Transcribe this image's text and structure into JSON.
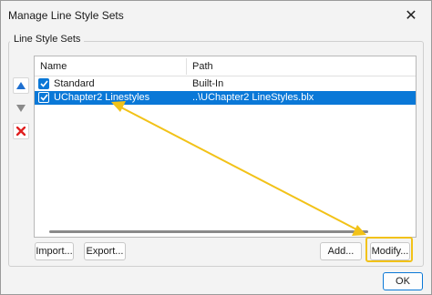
{
  "window": {
    "title": "Manage Line Style Sets",
    "close_icon": "close-icon"
  },
  "group": {
    "label": "Line Style Sets"
  },
  "side_buttons": [
    {
      "icon": "move-up-icon",
      "color": "#1e6fd0"
    },
    {
      "icon": "move-down-icon",
      "color": "#8a8a8a"
    },
    {
      "icon": "delete-icon",
      "color": "#e02020"
    }
  ],
  "list": {
    "columns": [
      "Name",
      "Path"
    ],
    "rows": [
      {
        "name": "Standard",
        "path": "Built-In",
        "checked": true,
        "selected": false
      },
      {
        "name": "UChapter2 Linestyles",
        "path": "..\\UChapter2 LineStyles.blx",
        "checked": true,
        "selected": true
      }
    ]
  },
  "buttons": {
    "import": "Import...",
    "export": "Export...",
    "add": "Add...",
    "modify": "Modify...",
    "ok": "OK"
  },
  "colors": {
    "selection": "#0a78d7",
    "annotation": "#f2c218"
  }
}
